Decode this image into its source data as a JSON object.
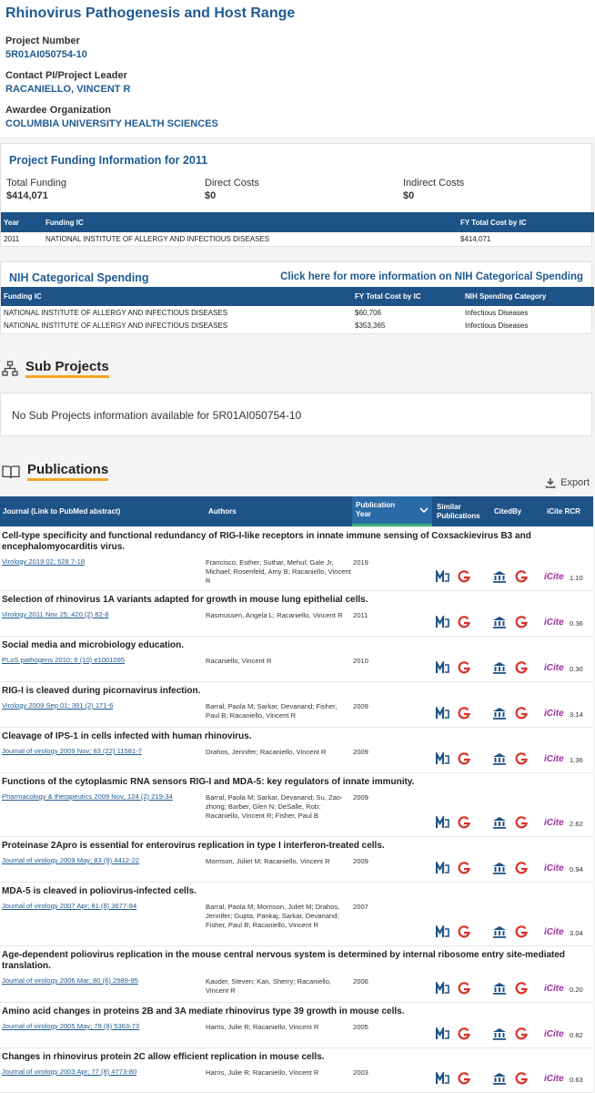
{
  "project": {
    "title": "Rhinovirus Pathogenesis and Host Range",
    "number_label": "Project Number",
    "number": "5R01AI050754-10",
    "pi_label": "Contact PI/Project Leader",
    "pi": "RACANIELLO, VINCENT R",
    "org_label": "Awardee Organization",
    "org": "COLUMBIA UNIVERSITY HEALTH SCIENCES"
  },
  "funding": {
    "title": "Project Funding Information for 2011",
    "total_label": "Total Funding",
    "total": "$414,071",
    "direct_label": "Direct Costs",
    "direct": "$0",
    "indirect_label": "Indirect Costs",
    "indirect": "$0",
    "headers": [
      "Year",
      "Funding IC",
      "FY Total Cost by IC"
    ],
    "rows": [
      [
        "2011",
        "NATIONAL INSTITUTE OF ALLERGY AND INFECTIOUS DISEASES",
        "$414,071"
      ]
    ]
  },
  "categorical": {
    "title": "NIH Categorical Spending",
    "link": "Click here for more information on NIH Categorical Spending",
    "headers": [
      "Funding IC",
      "FY Total Cost by IC",
      "NIH Spending Category"
    ],
    "rows": [
      [
        "NATIONAL INSTITUTE OF ALLERGY AND INFECTIOUS DISEASES",
        "$60,706",
        "Infectious Diseases"
      ],
      [
        "NATIONAL INSTITUTE OF ALLERGY AND INFECTIOUS DISEASES",
        "$353,365",
        "Infectious Diseases"
      ]
    ]
  },
  "subprojects": {
    "title": "Sub Projects",
    "empty": "No Sub Projects information available for 5R01AI050754-10"
  },
  "publications": {
    "title": "Publications",
    "export": "Export",
    "headers": {
      "journal": "Journal (Link to PubMed abstract)",
      "authors": "Authors",
      "year": "Publication Year",
      "similar": "Similar Publications",
      "citedby": "CitedBy",
      "icite": "iCite RCR"
    },
    "icite_label": "iCite",
    "items": [
      {
        "title": "Cell-type specificity and functional redundancy of RIG-I-like receptors in innate immune sensing of Coxsackievirus B3 and encephalomyocarditis virus.",
        "journal": "Virology 2019 02; 528 7-18",
        "authors": "Francisco, Esther; Suthar, Mehul; Gale Jr, Michael; Rosenfeld, Amy B; Racaniello, Vincent R",
        "year": "2019",
        "rcr": "1.10"
      },
      {
        "title": "Selection of rhinovirus 1A variants adapted for growth in mouse lung epithelial cells.",
        "journal": "Virology 2011 Nov 25; 420 (2) 82-8",
        "authors": "Rasmussen, Angela L; Racaniello, Vincent R",
        "year": "2011",
        "rcr": "0.36"
      },
      {
        "title": "Social media and microbiology education.",
        "journal": "PLoS pathogens 2010; 6 (10) e1001095",
        "authors": "Racaniello, Vincent R",
        "year": "2010",
        "rcr": "0.30"
      },
      {
        "title": "RIG-I is cleaved during picornavirus infection.",
        "journal": "Virology 2009 Sep 01; 391 (2) 171-6",
        "authors": "Barral, Paola M; Sarkar, Devanand; Fisher, Paul B; Racaniello, Vincent R",
        "year": "2009",
        "rcr": "3.14"
      },
      {
        "title": "Cleavage of IPS-1 in cells infected with human rhinovirus.",
        "journal": "Journal of virology 2009 Nov; 83 (22) 11581-7",
        "authors": "Drahos, Jennifer; Racaniello, Vincent R",
        "year": "2009",
        "rcr": "1.36"
      },
      {
        "title": "Functions of the cytoplasmic RNA sensors RIG-I and MDA-5: key regulators of innate immunity.",
        "journal": "Pharmacology & therapeutics 2009 Nov; 124 (2) 219-34",
        "authors": "Barral, Paola M; Sarkar, Devanand; Su, Zao-zhong; Barber, Glen N; DeSalle, Rob; Racaniello, Vincent R; Fisher, Paul B",
        "year": "2009",
        "rcr": "2.62"
      },
      {
        "title": "Proteinase 2Apro is essential for enterovirus replication in type I interferon-treated cells.",
        "journal": "Journal of virology 2009 May; 83 (9) 4412-22",
        "authors": "Morrison, Juliet M; Racaniello, Vincent R",
        "year": "2009",
        "rcr": "0.94"
      },
      {
        "title": "MDA-5 is cleaved in poliovirus-infected cells.",
        "journal": "Journal of virology 2007 Apr; 81 (8) 3677-84",
        "authors": "Barral, Paola M; Morrison, Juliet M; Drahos, Jennifer; Gupta, Pankaj; Sarkar, Devanand; Fisher, Paul B; Racaniello, Vincent R",
        "year": "2007",
        "rcr": "3.04"
      },
      {
        "title": "Age-dependent poliovirus replication in the mouse central nervous system is determined by internal ribosome entry site-mediated translation.",
        "journal": "Journal of virology 2006 Mar; 80 (6) 2589-95",
        "authors": "Kauder, Steven; Kan, Sherry; Racaniello, Vincent R",
        "year": "2006",
        "rcr": "0.20"
      },
      {
        "title": "Amino acid changes in proteins 2B and 3A mediate rhinovirus type 39 growth in mouse cells.",
        "journal": "Journal of virology 2005 May; 79 (9) 5363-73",
        "authors": "Harris, Julie R; Racaniello, Vincent R",
        "year": "2005",
        "rcr": "0.82"
      },
      {
        "title": "Changes in rhinovirus protein 2C allow efficient replication in mouse cells.",
        "journal": "Journal of virology 2003 Apr; 77 (8) 4773-80",
        "authors": "Harris, Julie R; Racaniello, Vincent R",
        "year": "2003",
        "rcr": "0.63"
      }
    ]
  }
}
